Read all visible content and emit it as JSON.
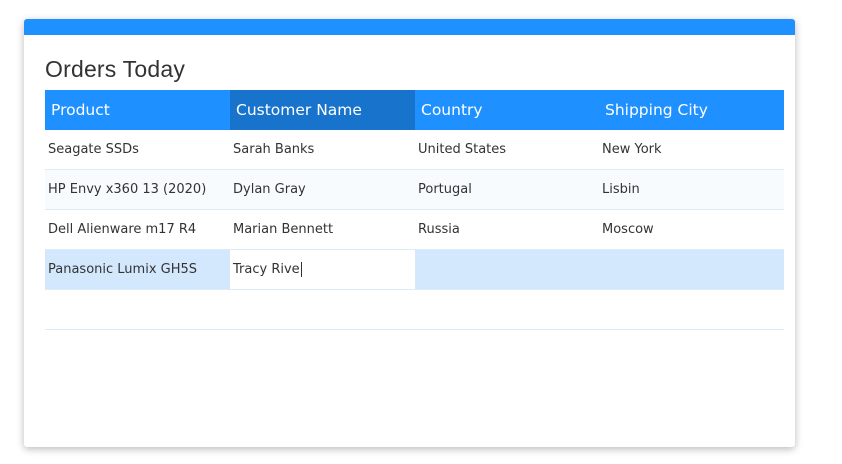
{
  "title": "Orders Today",
  "columns": [
    "Product",
    "Customer Name",
    "Country",
    "Shipping City"
  ],
  "rows": [
    {
      "product": "Seagate SSDs",
      "customer": "Sarah Banks",
      "country": "United States",
      "city": "New York"
    },
    {
      "product": "HP Envy x360 13 (2020)",
      "customer": "Dylan Gray",
      "country": "Portugal",
      "city": "Lisbin"
    },
    {
      "product": "Dell Alienware m17 R4",
      "customer": "Marian Bennett",
      "country": "Russia",
      "city": "Moscow"
    },
    {
      "product": "Panasonic Lumix GH5S",
      "customer": "Tracy Rive",
      "country": "",
      "city": ""
    }
  ],
  "colors": {
    "accent": "#1e90ff",
    "active_header": "#1873cc",
    "selected_row": "#d4e8fd"
  }
}
